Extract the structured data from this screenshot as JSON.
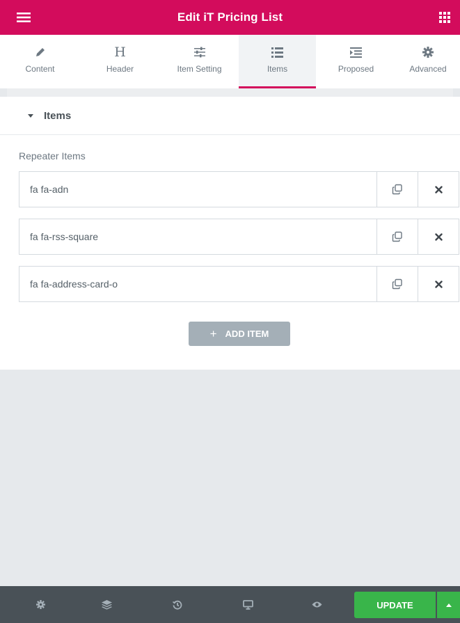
{
  "header": {
    "title": "Edit iT Pricing List",
    "menu_icon": "hamburger-icon",
    "apps_icon": "grid-icon",
    "brand_color": "#d30c5c"
  },
  "tabs": [
    {
      "label": "Content",
      "icon": "pencil-icon",
      "active": false
    },
    {
      "label": "Header",
      "icon": "heading-icon",
      "active": false
    },
    {
      "label": "Item Setting",
      "icon": "sliders-icon",
      "active": false
    },
    {
      "label": "Items",
      "icon": "list-icon",
      "active": true
    },
    {
      "label": "Proposed",
      "icon": "indent-icon",
      "active": false
    },
    {
      "label": "Advanced",
      "icon": "gear-icon",
      "active": false
    }
  ],
  "section": {
    "title": "Items",
    "repeater_label": "Repeater Items",
    "items": [
      {
        "title": "fa fa-adn"
      },
      {
        "title": "fa fa-rss-square"
      },
      {
        "title": "fa fa-address-card-o"
      }
    ],
    "add_item_label": "ADD ITEM"
  },
  "footer": {
    "icons": [
      "settings-icon",
      "layers-icon",
      "history-icon",
      "responsive-icon",
      "preview-icon"
    ],
    "update_label": "UPDATE",
    "update_color": "#39b54a"
  }
}
